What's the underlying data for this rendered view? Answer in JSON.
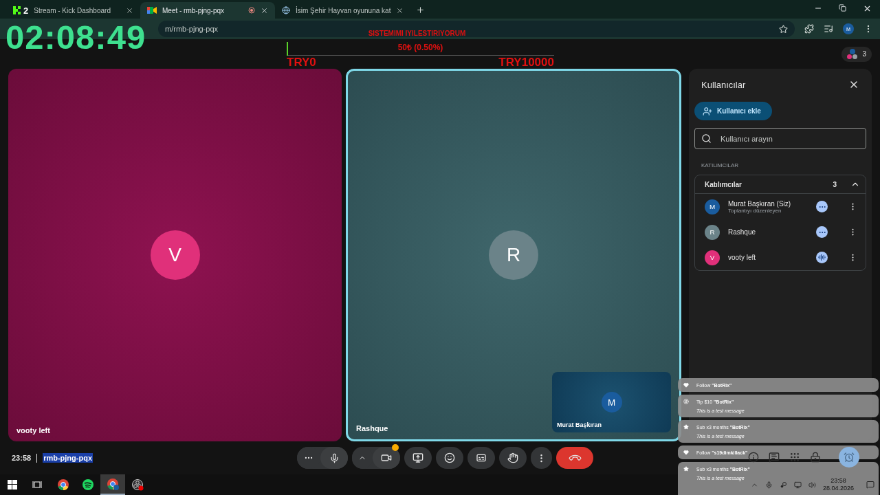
{
  "browser": {
    "tabs": [
      {
        "title": "Stream - Kick Dashboard",
        "kind": "kick",
        "badge": "2",
        "selected": false
      },
      {
        "title": "Meet - rmb-pjng-pqx",
        "kind": "meet",
        "recording": true,
        "selected": true
      },
      {
        "title": "İsim Şehir Hayvan oyununa kat",
        "kind": "globe",
        "selected": false
      }
    ],
    "url": "m/rmb-pjng-pqx",
    "profile": "M"
  },
  "overlay": {
    "clock": "02:08:49",
    "goal": {
      "title": "SISTEMIMI IYILESTIRIYORUM",
      "amount": "50₺ (0.50%)",
      "level": 0.005,
      "min": "TRY0",
      "max": "TRY10000"
    }
  },
  "meet": {
    "participant_count": "3",
    "tiles": [
      {
        "name": "vooty left",
        "initial": "V",
        "color": "#e0307a",
        "speaking": false
      },
      {
        "name": "Rashque",
        "initial": "R",
        "color": "#6b8389",
        "speaking": true
      }
    ],
    "self_view": {
      "name": "Murat Başkıran",
      "initial": "M",
      "color": "#1a5c9e"
    },
    "panel": {
      "title": "Kullanıcılar",
      "add_button": "Kullanıcı ekle",
      "search": {
        "placeholder": "Kullanıcı arayın"
      },
      "section": "KATILIMCILAR",
      "group": {
        "title": "Katılımcılar",
        "count": "3",
        "expanded": true,
        "participants": [
          {
            "name": "Murat Başkıran (Siz)",
            "role": "Toplantıyı düzenleyen",
            "initial": "M",
            "color": "#1a5c9e",
            "speaking": false
          },
          {
            "name": "Rashque",
            "initial": "R",
            "color": "#6b8389",
            "speaking": false
          },
          {
            "name": "vooty left",
            "initial": "V",
            "color": "#e0307a",
            "speaking": true
          }
        ]
      }
    },
    "time": "23:58",
    "meeting_code": "rmb-pjng-pqx",
    "mic_on": true,
    "camera_warning": true
  },
  "notifications": [
    {
      "kind": "follow",
      "title": "Follow **\"BotRix\"**"
    },
    {
      "kind": "tip",
      "title": "Tip $10 **\"BotRix\"**",
      "message": "This is a test message"
    },
    {
      "kind": "sub",
      "title": "Sub x3 months **\"BotRix\"**",
      "message": "This is a test message"
    },
    {
      "kind": "follow",
      "title": "Follow **\"s19dimkillack\"**"
    },
    {
      "kind": "sub",
      "title": "Sub x3 months **\"BotRix\"**",
      "message": "This is a test message"
    }
  ],
  "taskbar": {
    "apps": [
      {
        "kind": "start",
        "active": false
      },
      {
        "kind": "taskview",
        "active": false
      },
      {
        "kind": "chrome",
        "active": false
      },
      {
        "kind": "spotify",
        "active": false
      },
      {
        "kind": "chrome-profile",
        "active": true
      },
      {
        "kind": "obs",
        "active": false
      }
    ],
    "time": "23:58",
    "date": "28.04.2026"
  }
}
